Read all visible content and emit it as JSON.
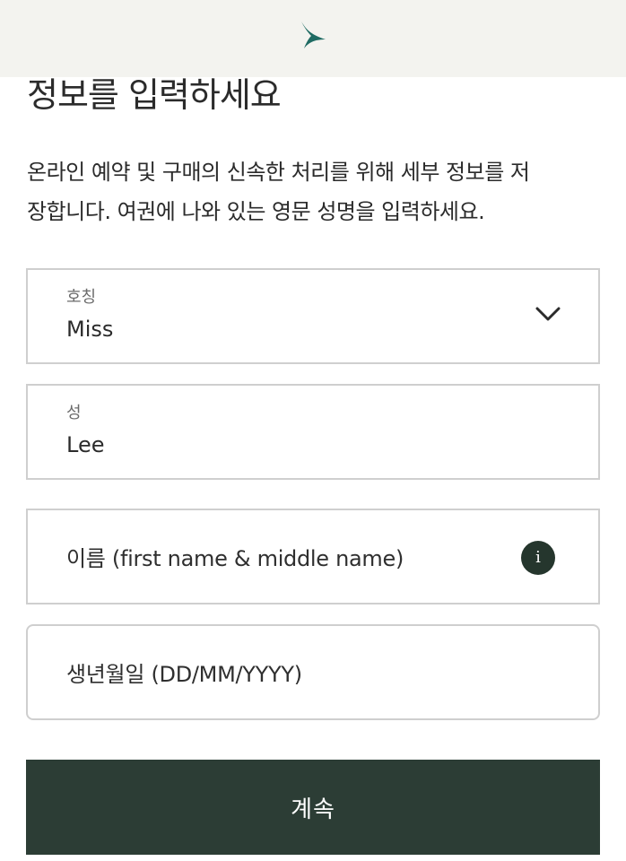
{
  "header": {
    "logo_icon": "cathay-brushwing-logo",
    "logo_color": "#1f6b63"
  },
  "page": {
    "title": "정보를 입력하세요",
    "description_line1": "온라인 예약 및 구매의 신속한 처리를 위해 세부 정보를 저",
    "description_line2": "장합니다. 여권에 나와 있는 영문 성명을 입력하세요."
  },
  "form": {
    "title_field": {
      "label": "호칭",
      "value": "Miss",
      "icon": "chevron-down-icon"
    },
    "surname_field": {
      "label": "성",
      "value": "Lee"
    },
    "given_name_field": {
      "placeholder": "이름 (first name & middle name)",
      "info_icon": "i"
    },
    "birthdate_field": {
      "placeholder": "생년월일 (DD/MM/YYYY)"
    }
  },
  "actions": {
    "continue_label": "계속",
    "continue_color": "#2c3d35"
  }
}
